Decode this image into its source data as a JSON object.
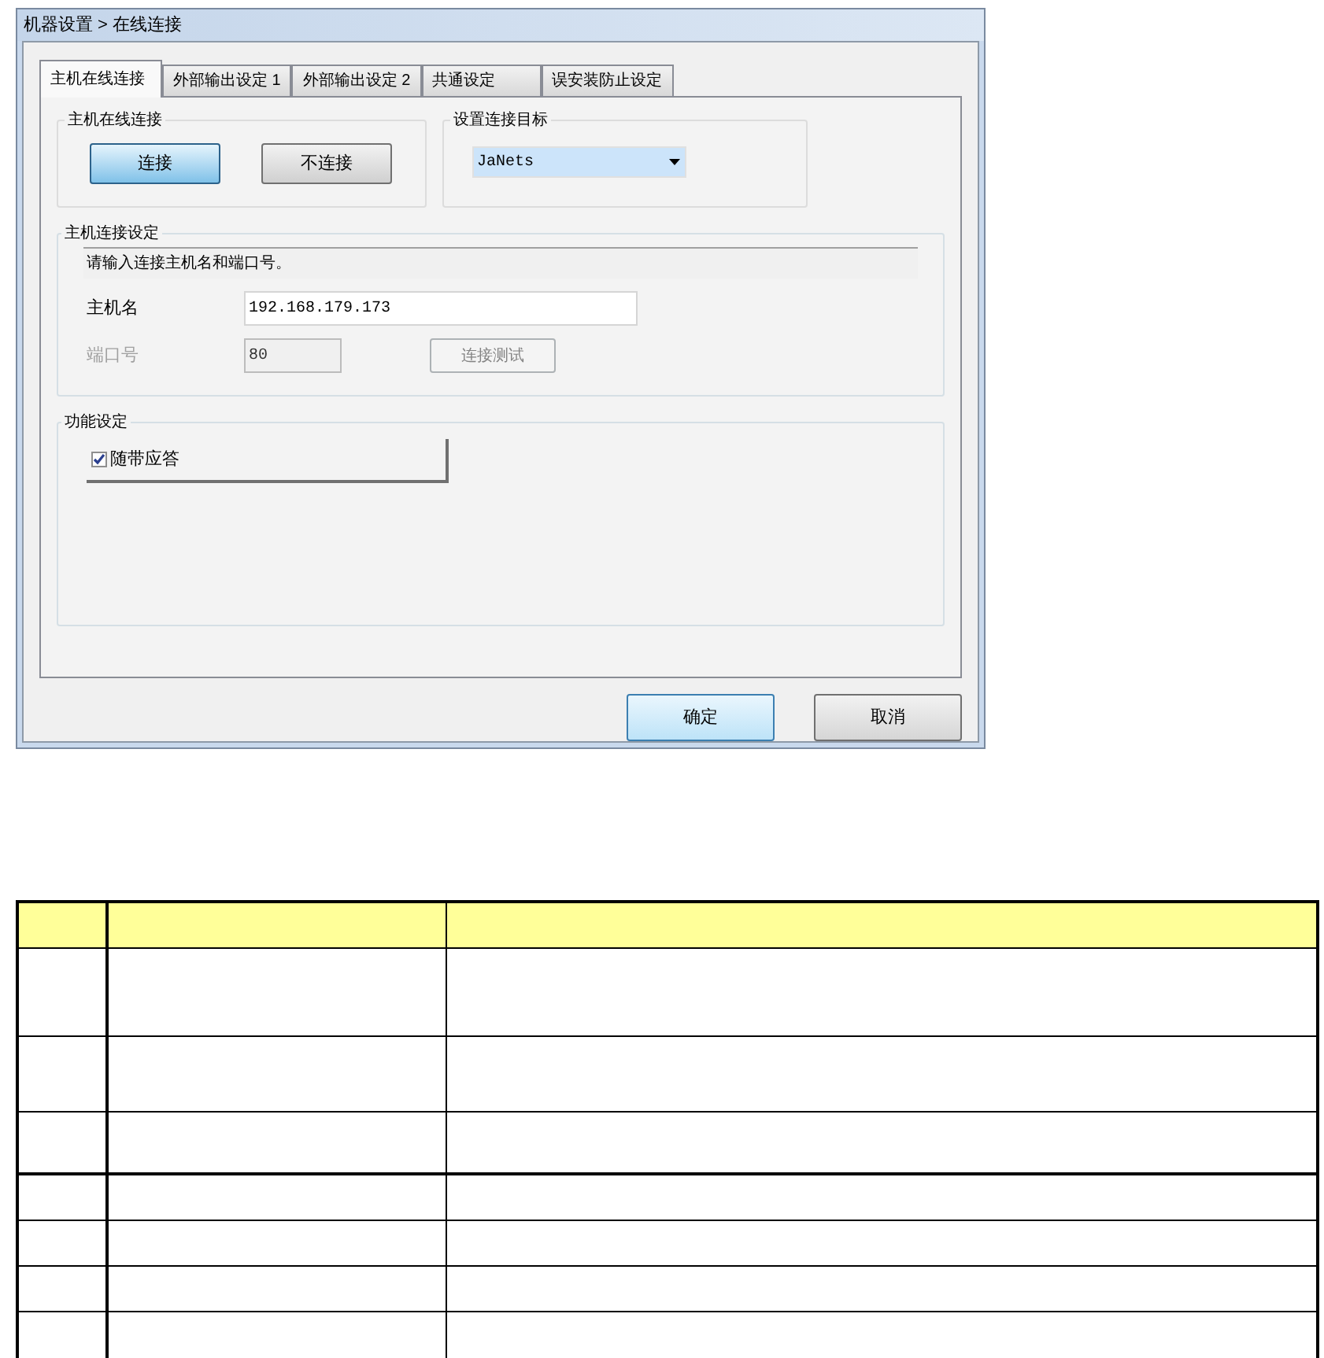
{
  "window": {
    "title": "机器设置 > 在线连接"
  },
  "tabs": [
    {
      "label": "主机在线连接",
      "selected": true
    },
    {
      "label": "外部输出设定 1",
      "selected": false
    },
    {
      "label": "外部输出设定 2",
      "selected": false
    },
    {
      "label": "共通设定",
      "selected": false
    },
    {
      "label": "误安装防止设定",
      "selected": false
    }
  ],
  "online_group": {
    "title": "主机在线连接",
    "buttons": [
      {
        "label": "连接",
        "selected": true
      },
      {
        "label": "不连接",
        "selected": false
      }
    ]
  },
  "target_group": {
    "title": "设置连接目标",
    "dropdown": {
      "value": "JaNets"
    }
  },
  "host_group": {
    "title": "主机连接设定",
    "message": "请输入连接主机名和端口号。",
    "host": {
      "label": "主机名",
      "value": "192.168.179.173",
      "disabled": false
    },
    "port": {
      "label": "端口号",
      "value": "80",
      "disabled": true
    },
    "test_button": {
      "label": "连接测试",
      "disabled": true
    }
  },
  "function_group": {
    "title": "功能设定",
    "checkbox": {
      "label": "随带应答",
      "checked": true
    }
  },
  "footer_buttons": [
    {
      "label": "确定",
      "focused": true
    },
    {
      "label": "取消",
      "focused": false
    }
  ],
  "table": {
    "rows": [
      {
        "kind": "tall"
      },
      {
        "kind": "medium"
      },
      {
        "kind": "short"
      },
      {
        "kind": "single"
      },
      {
        "kind": "single"
      },
      {
        "kind": "single"
      },
      {
        "kind": "single"
      }
    ]
  }
}
